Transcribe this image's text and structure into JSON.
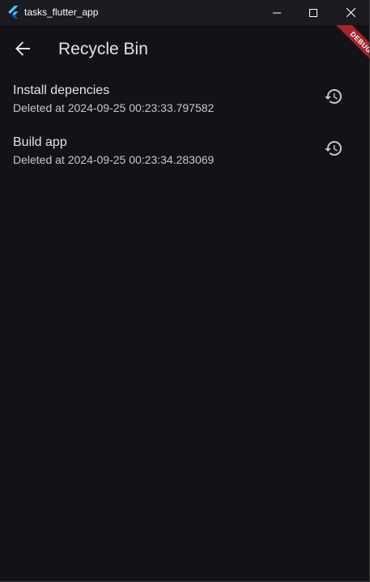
{
  "window": {
    "title": "tasks_flutter_app",
    "icon": "flutter-logo-icon"
  },
  "appbar": {
    "title": "Recycle Bin",
    "back_icon": "arrow-back-icon"
  },
  "debug_banner": {
    "label": "DEBUG",
    "color": "#a3272d"
  },
  "tasks": [
    {
      "title": "Install depencies",
      "subtitle": "Deleted at 2024-09-25 00:23:33.797582",
      "action_icon": "restore-history-icon"
    },
    {
      "title": "Build app",
      "subtitle": "Deleted at 2024-09-25 00:23:34.283069",
      "action_icon": "restore-history-icon"
    }
  ],
  "colors": {
    "background": "#141218",
    "text_primary": "#e6e0e9",
    "text_secondary": "#cac4d0"
  }
}
